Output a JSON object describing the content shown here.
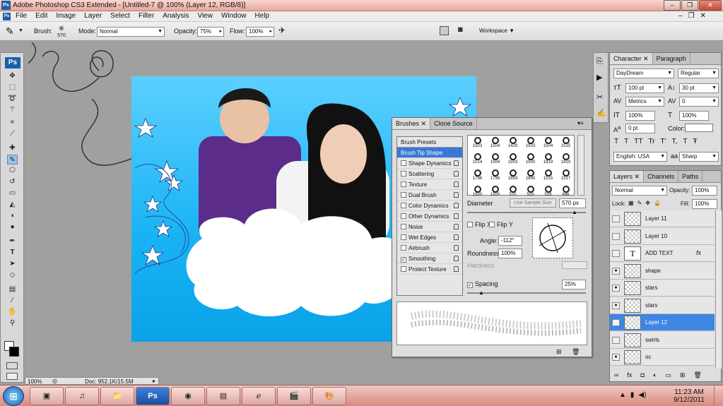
{
  "window": {
    "title": "Adobe Photoshop CS3 Extended - [Untitled-7 @ 100% (Layer 12, RGB/8)]",
    "app_badge": "Ps"
  },
  "menu": [
    "File",
    "Edit",
    "Image",
    "Layer",
    "Select",
    "Filter",
    "Analysis",
    "View",
    "Window",
    "Help"
  ],
  "options": {
    "brush_label": "Brush:",
    "brush_size": "570",
    "mode_label": "Mode:",
    "mode_value": "Normal",
    "opacity_label": "Opacity:",
    "opacity_value": "75%",
    "flow_label": "Flow:",
    "flow_value": "100%",
    "workspace": "Workspace"
  },
  "toolbox": {
    "logo": "Ps"
  },
  "status": {
    "zoom": "100%",
    "doc": "Doc: 952.1K/15.5M"
  },
  "brushes": {
    "tabs": [
      "Brushes",
      "Clone Source"
    ],
    "presets_label": "Brush Presets",
    "items": [
      {
        "label": "Brush Tip Shape",
        "checked": "",
        "lock": false,
        "hl": true
      },
      {
        "label": "Shape Dynamics",
        "checked": "",
        "lock": true
      },
      {
        "label": "Scattering",
        "checked": "",
        "lock": true
      },
      {
        "label": "Texture",
        "checked": "",
        "lock": true
      },
      {
        "label": "Dual Brush",
        "checked": "",
        "lock": true
      },
      {
        "label": "Color Dynamics",
        "checked": "",
        "lock": true
      },
      {
        "label": "Other Dynamics",
        "checked": "",
        "lock": true
      },
      {
        "label": "Noise",
        "checked": "",
        "lock": true
      },
      {
        "label": "Wet Edges",
        "checked": "",
        "lock": true
      },
      {
        "label": "Airbrush",
        "checked": "",
        "lock": true
      },
      {
        "label": "Smoothing",
        "checked": "✓",
        "lock": true
      },
      {
        "label": "Protect Texture",
        "checked": "",
        "lock": true
      }
    ],
    "tips": [
      "1503",
      "1504",
      "1429",
      "1503",
      "1504",
      "1515",
      "1514",
      "1504",
      "1503",
      "1500",
      "1819",
      "1819",
      "1796",
      "1796",
      "1893",
      "1895",
      "1515",
      "1517",
      "1500",
      "1500",
      "570",
      "503",
      "529",
      "686"
    ],
    "diameter_label": "Diameter",
    "diameter_button": "Use Sample Size",
    "diameter_value": "570 px",
    "flipx": "Flip X",
    "flipy": "Flip Y",
    "angle_label": "Angle:",
    "angle_value": "-112°",
    "roundness_label": "Roundness:",
    "roundness_value": "100%",
    "hardness_label": "Hardness",
    "spacing_label": "Spacing",
    "spacing_value": "25%"
  },
  "character": {
    "tabs": [
      "Character",
      "Paragraph"
    ],
    "font": "DayDream",
    "style": "Regular",
    "size": "100 pt",
    "leading": "30 pt",
    "kerning": "Metrics",
    "tracking": "0",
    "vscale": "100%",
    "hscale": "100%",
    "baseline": "0 pt",
    "color_label": "Color:",
    "styles": [
      "T",
      "T",
      "TT",
      "Tr",
      "T'",
      "T,",
      "T",
      "Ŧ"
    ],
    "language": "English: USA",
    "aa_label": "aa",
    "aa": "Sharp"
  },
  "layers": {
    "tabs": [
      "Layers",
      "Channels",
      "Paths"
    ],
    "blend": "Normal",
    "opacity_label": "Opacity:",
    "opacity": "100%",
    "lock_label": "Lock:",
    "fill_label": "Fill:",
    "fill": "100%",
    "rows": [
      {
        "name": "Layer 11",
        "eye": ""
      },
      {
        "name": "Layer 10",
        "eye": ""
      },
      {
        "name": "ADD TEXT",
        "eye": "",
        "text": true
      },
      {
        "name": "shape",
        "eye": "●"
      },
      {
        "name": "stars",
        "eye": "●"
      },
      {
        "name": "stars",
        "eye": "●"
      },
      {
        "name": "Layer 12",
        "eye": "●",
        "active": true
      },
      {
        "name": "swirls",
        "eye": ""
      },
      {
        "name": "oc",
        "eye": "●"
      }
    ]
  },
  "taskbar": {
    "time": "11:23 AM",
    "date": "9/12/2011",
    "ps_label": "Ps"
  }
}
